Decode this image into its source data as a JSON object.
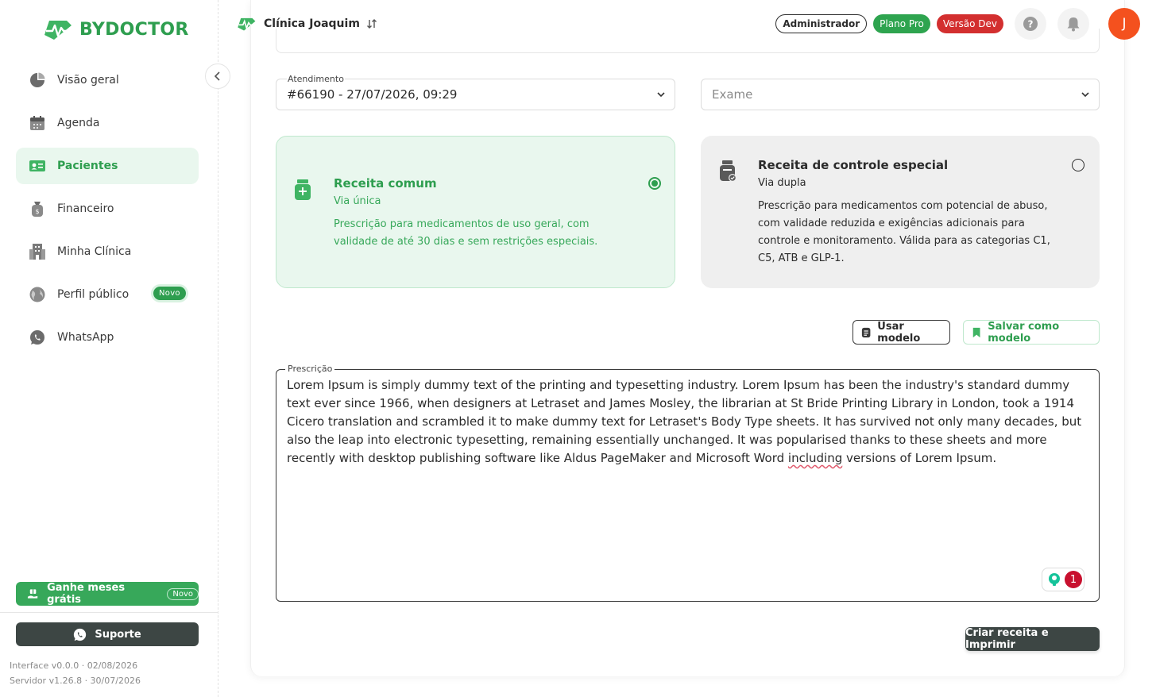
{
  "brand": {
    "name": "BYDOCTOR",
    "color": "#2e9e4f"
  },
  "sidebar": {
    "items": [
      {
        "label": "Visão geral",
        "icon": "pie-chart-icon"
      },
      {
        "label": "Agenda",
        "icon": "calendar-icon"
      },
      {
        "label": "Pacientes",
        "icon": "patient-card-icon",
        "active": true
      },
      {
        "label": "Financeiro",
        "icon": "money-bag-icon"
      },
      {
        "label": "Minha Clínica",
        "icon": "building-icon"
      },
      {
        "label": "Perfil público",
        "icon": "globe-icon",
        "badge": "Novo"
      },
      {
        "label": "WhatsApp",
        "icon": "whatsapp-icon"
      }
    ],
    "promo": {
      "label": "Ganhe meses grátis",
      "badge": "Novo"
    },
    "support": {
      "label": "Suporte"
    },
    "version_interface": "Interface v0.0.0 · 02/08/2026",
    "version_server": "Servidor v1.26.8 · 30/07/2026"
  },
  "header": {
    "clinic_name": "Clínica Joaquim",
    "badges": {
      "admin": "Administrador",
      "plan": "Plano Pro",
      "version": "Versão Dev"
    },
    "avatar_initial": "J"
  },
  "form": {
    "atendimento": {
      "label": "Atendimento",
      "value": "#66190 - 27/07/2026, 09:29"
    },
    "exame": {
      "placeholder": "Exame"
    },
    "receita_comum": {
      "title": "Receita comum",
      "subtitle": "Via única",
      "description": "Prescrição para medicamentos de uso geral, com validade de até 30 dias e sem restrições especiais.",
      "selected": true
    },
    "receita_especial": {
      "title": "Receita de controle especial",
      "subtitle": "Via dupla",
      "description": "Prescrição para medicamentos com potencial de abuso, com validade reduzida e exigências adicionais para controle e monitoramento. Válida para as categorias C1, C5, ATB e GLP-1.",
      "selected": false
    },
    "use_model_label": "Usar modelo",
    "save_model_label": "Salvar como modelo",
    "prescricao": {
      "label": "Prescrição",
      "text_before": "Lorem Ipsum is simply dummy text of the printing and typesetting industry. Lorem Ipsum has been the industry's standard dummy text ever since 1966, when designers at Letraset and James Mosley, the librarian at St Bride Printing Library in London, took a 1914 Cicero translation and scrambled it to make dummy text for Letraset's Body Type sheets. It has survived not only many decades, but also the leap into electronic typesetting, remaining essentially unchanged. It was popularised thanks to these sheets and more recently with desktop publishing software like Aldus PageMaker and Microsoft Word ",
      "text_flagged": "including",
      "text_after": " versions of Lorem Ipsum.",
      "grammar_issues": "1"
    },
    "submit_label": "Criar receita e Imprimir"
  }
}
